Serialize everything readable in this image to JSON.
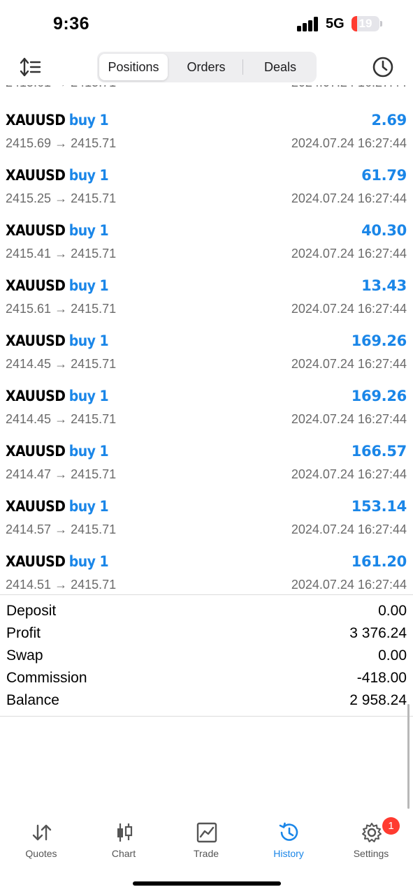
{
  "status_bar": {
    "time": "9:36",
    "network": "5G",
    "battery": "19"
  },
  "top_nav": {
    "tabs": [
      {
        "label": "Positions",
        "active": true
      },
      {
        "label": "Orders",
        "active": false
      },
      {
        "label": "Deals",
        "active": false
      }
    ],
    "sort_icon": "sort-icon",
    "history_icon": "clock-icon"
  },
  "deals": [
    {
      "symbol": "XAUUSD",
      "type": "buy 1",
      "profit": "2.69",
      "open_price": "2415.69",
      "arrow": "→",
      "close_price": "2415.71",
      "time": "2024.07.24 16:27:44"
    },
    {
      "symbol": "XAUUSD",
      "type": "buy 1",
      "profit": "61.79",
      "open_price": "2415.25",
      "arrow": "→",
      "close_price": "2415.71",
      "time": "2024.07.24 16:27:44"
    },
    {
      "symbol": "XAUUSD",
      "type": "buy 1",
      "profit": "40.30",
      "open_price": "2415.41",
      "arrow": "→",
      "close_price": "2415.71",
      "time": "2024.07.24 16:27:44"
    },
    {
      "symbol": "XAUUSD",
      "type": "buy 1",
      "profit": "13.43",
      "open_price": "2415.61",
      "arrow": "→",
      "close_price": "2415.71",
      "time": "2024.07.24 16:27:44"
    },
    {
      "symbol": "XAUUSD",
      "type": "buy 1",
      "profit": "169.26",
      "open_price": "2414.45",
      "arrow": "→",
      "close_price": "2415.71",
      "time": "2024.07.24 16:27:44"
    },
    {
      "symbol": "XAUUSD",
      "type": "buy 1",
      "profit": "169.26",
      "open_price": "2414.45",
      "arrow": "→",
      "close_price": "2415.71",
      "time": "2024.07.24 16:27:44"
    },
    {
      "symbol": "XAUUSD",
      "type": "buy 1",
      "profit": "166.57",
      "open_price": "2414.47",
      "arrow": "→",
      "close_price": "2415.71",
      "time": "2024.07.24 16:27:44"
    },
    {
      "symbol": "XAUUSD",
      "type": "buy 1",
      "profit": "153.14",
      "open_price": "2414.57",
      "arrow": "→",
      "close_price": "2415.71",
      "time": "2024.07.24 16:27:44"
    },
    {
      "symbol": "XAUUSD",
      "type": "buy 1",
      "profit": "161.20",
      "open_price": "2414.51",
      "arrow": "→",
      "close_price": "2415.71",
      "time": "2024.07.24 16:27:44"
    }
  ],
  "summary": [
    {
      "label": "Deposit",
      "value": "0.00"
    },
    {
      "label": "Profit",
      "value": "3 376.24"
    },
    {
      "label": "Swap",
      "value": "0.00"
    },
    {
      "label": "Commission",
      "value": "-418.00"
    },
    {
      "label": "Balance",
      "value": "2 958.24"
    }
  ],
  "tabbar": {
    "items": [
      {
        "label": "Quotes",
        "icon": "quotes-arrows-icon",
        "active": false
      },
      {
        "label": "Chart",
        "icon": "candlestick-icon",
        "active": false
      },
      {
        "label": "Trade",
        "icon": "trade-chart-icon",
        "active": false
      },
      {
        "label": "History",
        "icon": "history-icon",
        "active": true
      },
      {
        "label": "Settings",
        "icon": "gear-icon",
        "active": false,
        "badge": "1"
      }
    ]
  },
  "colors": {
    "accent": "#1a86e8",
    "badge": "#ff3b30",
    "secondary_text": "#6b6b6b"
  }
}
